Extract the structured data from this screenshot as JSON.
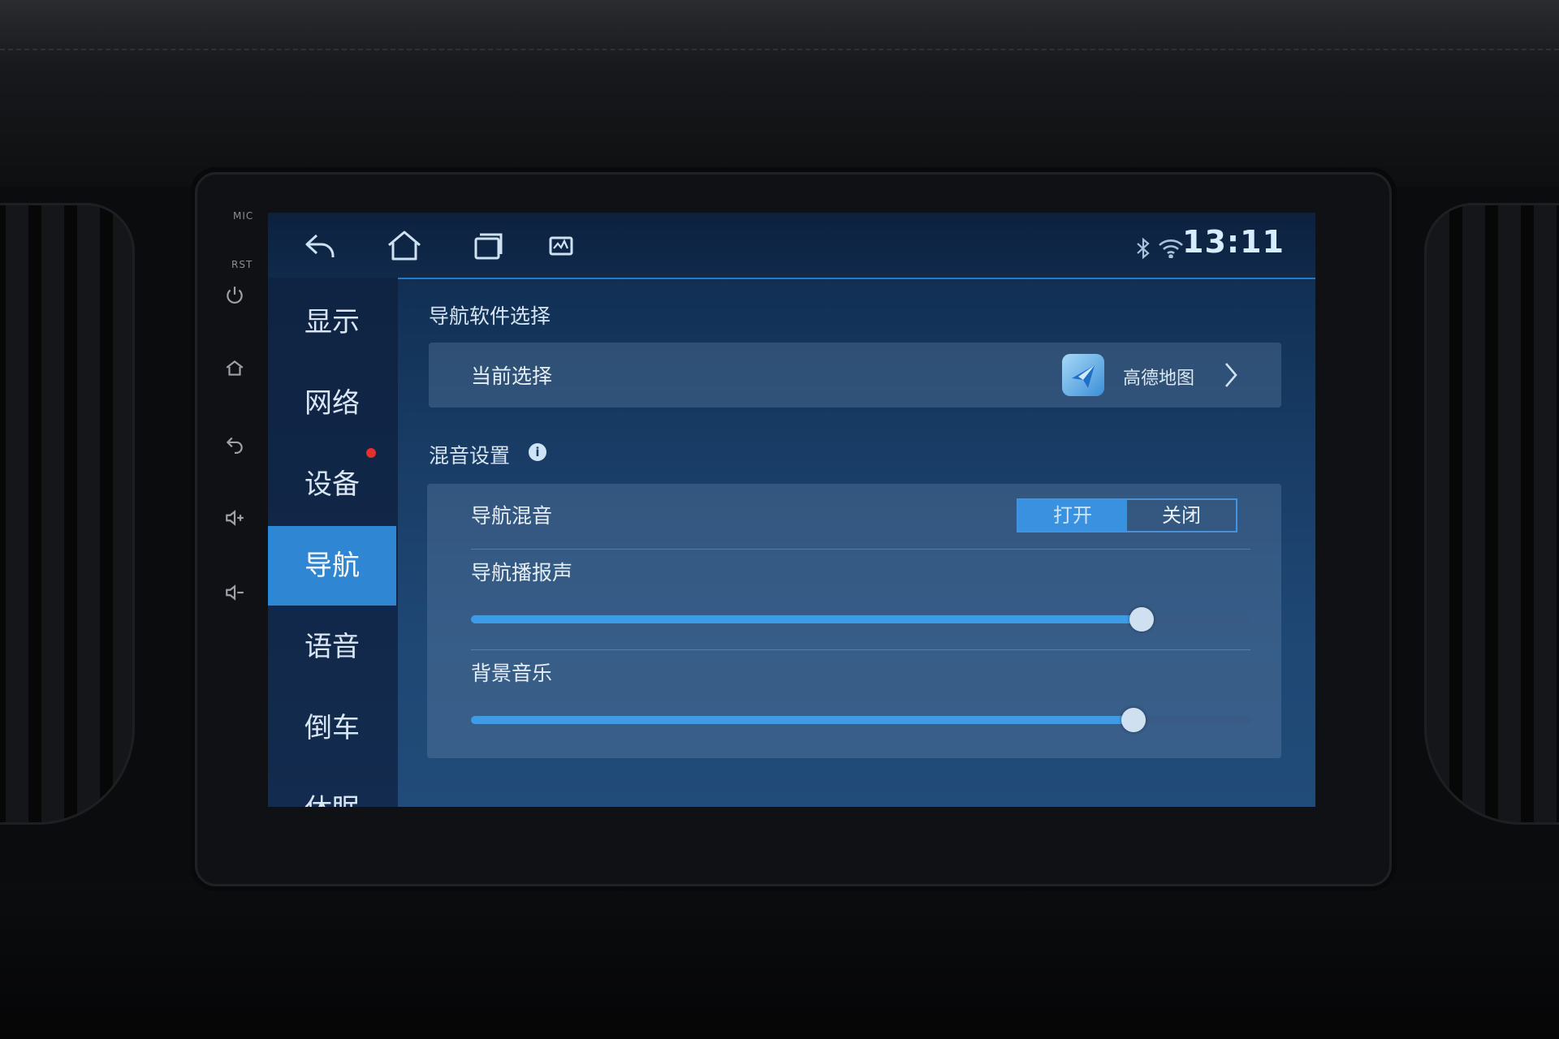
{
  "hardware": {
    "mic_label": "MIC",
    "rst_label": "RST"
  },
  "topbar": {
    "icons": [
      "back-icon",
      "home-icon",
      "recent-apps-icon",
      "monitor-icon"
    ],
    "status_icons": [
      "bluetooth-icon",
      "wifi-icon"
    ],
    "clock": "13:11"
  },
  "sidebar": {
    "items": [
      {
        "label": "显示"
      },
      {
        "label": "网络"
      },
      {
        "label": "设备"
      },
      {
        "label": "导航",
        "active": true
      },
      {
        "label": "语音"
      },
      {
        "label": "倒车"
      },
      {
        "label": "休眠"
      }
    ]
  },
  "nav_software": {
    "title": "导航软件选择",
    "current_label": "当前选择",
    "app_name": "高德地图"
  },
  "mixing": {
    "title": "混音设置",
    "nav_mix_label": "导航混音",
    "toggle_on": "打开",
    "toggle_off": "关闭",
    "toggle_selected": "打开",
    "nav_voice_label": "导航播报声",
    "nav_voice_level": 0.86,
    "bg_music_label": "背景音乐",
    "bg_music_level": 0.85
  },
  "colors": {
    "accent": "#2f86d2",
    "notification": "#e0312f"
  }
}
